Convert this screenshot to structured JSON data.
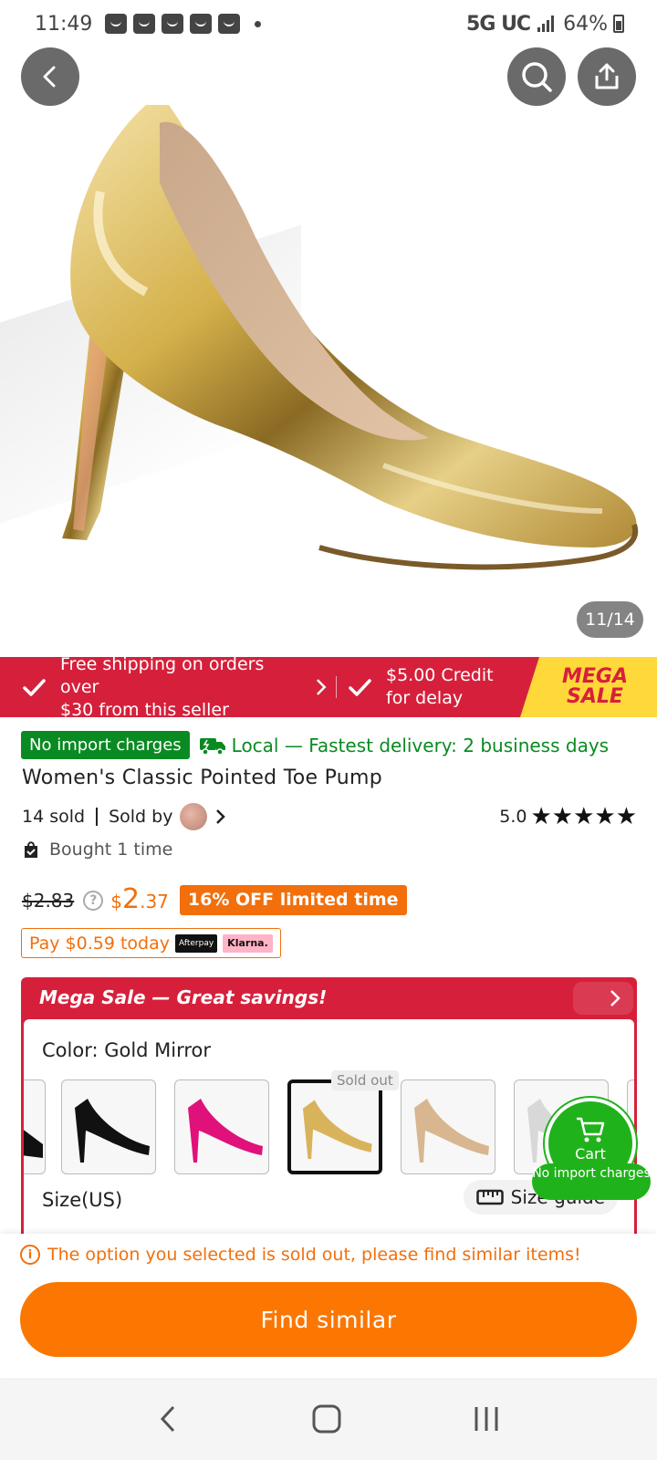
{
  "status_bar": {
    "time": "11:49",
    "network": "5G UC",
    "battery": "64%"
  },
  "gallery": {
    "counter": "11/14"
  },
  "promo": {
    "shipping_text_line1": "Free shipping on orders over",
    "shipping_text_line2": "$30 from this seller",
    "credit_line1": "$5.00 Credit",
    "credit_line2": "for delay",
    "mega_line1": "MEGA",
    "mega_line2": "SALE"
  },
  "product": {
    "import_tag": "No import charges",
    "delivery": "Local — Fastest delivery: 2 business days",
    "title": "Women's Classic Pointed Toe Pump",
    "sold": "14 sold",
    "sold_by": "Sold by",
    "rating": "5.0",
    "stars": "★★★★★",
    "bought": "Bought 1 time",
    "old_price": "$2.83",
    "price_symbol": "$",
    "price_whole": "2",
    "price_cents": ".37",
    "discount": "16% OFF limited time",
    "pay_today": "Pay $0.59 today",
    "afterpay": "Afterpay",
    "klarna": "Klarna."
  },
  "sale_box": {
    "title": "Mega Sale — Great savings!",
    "color_label": "Color: Gold Mirror",
    "sold_out": "Sold out",
    "size_label": "Size(US)",
    "size_guide": "Size guide",
    "colors": [
      "black",
      "#111111",
      "#e0117a",
      "#d9b35c",
      "#d8b690",
      "#d8d8d8"
    ]
  },
  "cart": {
    "label": "Cart",
    "tag": "No import charges"
  },
  "bottom": {
    "warning": "The option you selected is sold out, please find similar items!",
    "button": "Find similar"
  }
}
